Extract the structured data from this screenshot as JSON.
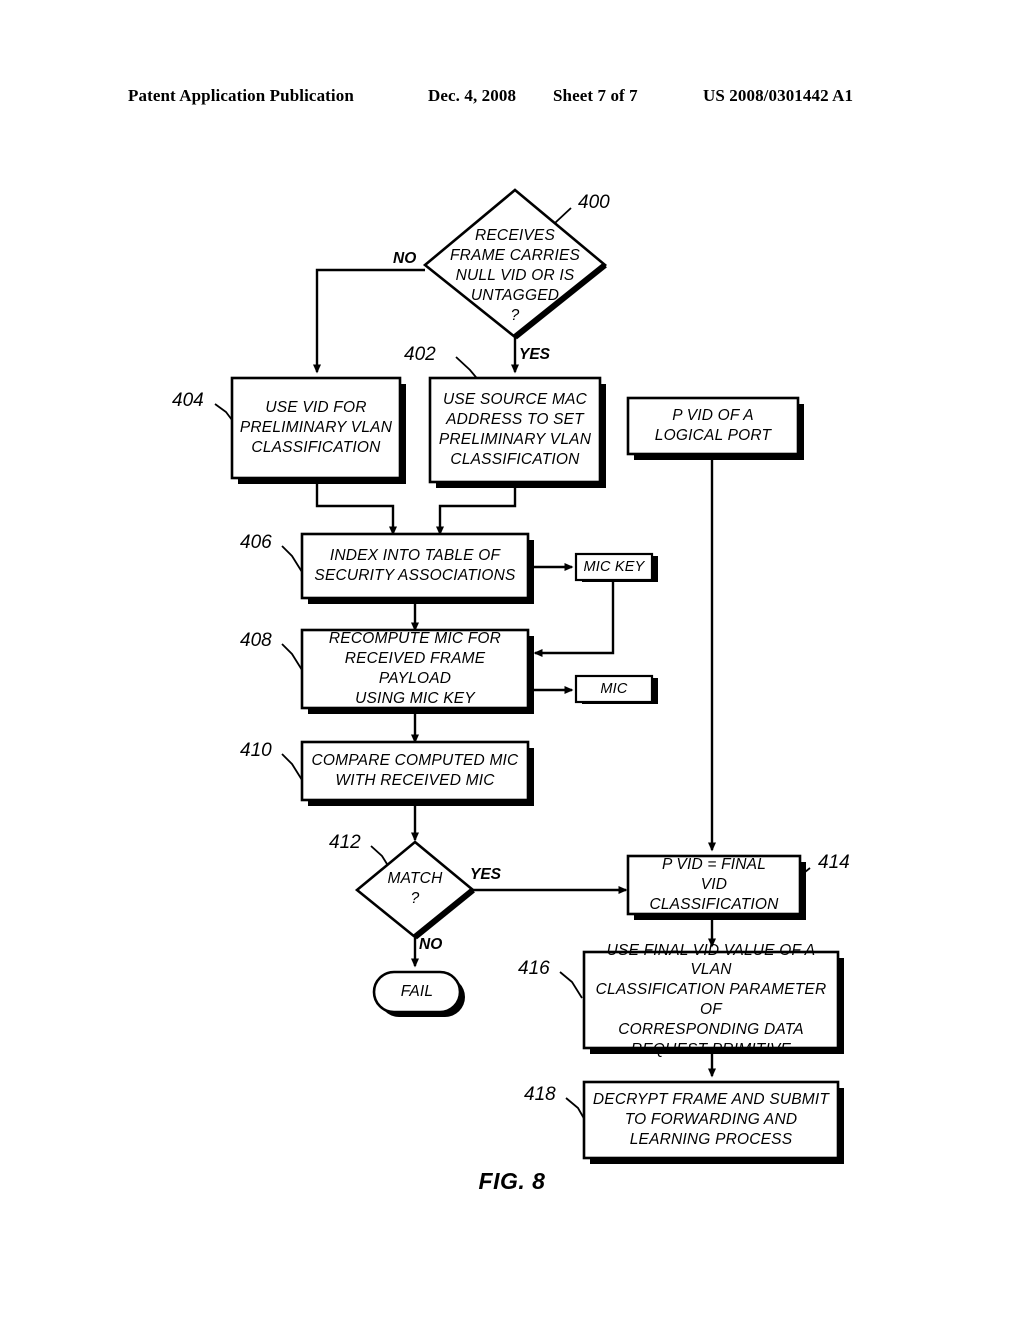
{
  "header": {
    "publication": "Patent Application Publication",
    "date": "Dec. 4, 2008",
    "sheet": "Sheet 7 of 7",
    "number": "US 2008/0301442 A1"
  },
  "figure": {
    "caption": "FIG. 8",
    "nodes": {
      "n400": {
        "ref": "400",
        "text": "RECEIVES\nFRAME CARRIES\nNULL VID OR IS\nUNTAGGED\n?",
        "shape": "decision"
      },
      "n402": {
        "ref": "402",
        "text": "USE SOURCE MAC\nADDRESS TO SET\nPRELIMINARY VLAN\nCLASSIFICATION",
        "shape": "process"
      },
      "n404": {
        "ref": "404",
        "text": "USE VID FOR\nPRELIMINARY VLAN\nCLASSIFICATION",
        "shape": "process"
      },
      "n406": {
        "ref": "406",
        "text": "INDEX INTO TABLE OF\nSECURITY ASSOCIATIONS",
        "shape": "process"
      },
      "n408": {
        "ref": "408",
        "text": "RECOMPUTE MIC FOR\nRECEIVED FRAME PAYLOAD\nUSING MIC KEY",
        "shape": "process"
      },
      "n410": {
        "ref": "410",
        "text": "COMPARE COMPUTED MIC\nWITH RECEIVED MIC",
        "shape": "process"
      },
      "n412": {
        "ref": "412",
        "text": "MATCH\n?",
        "shape": "decision"
      },
      "n414": {
        "ref": "414",
        "text": "P VID = FINAL\nVID CLASSIFICATION",
        "shape": "process"
      },
      "n416": {
        "ref": "416",
        "text": "USE FINAL VID VALUE OF A VLAN\nCLASSIFICATION PARAMETER OF\nCORRESPONDING DATA\nREQUEST PRIMITIVE",
        "shape": "process"
      },
      "n418": {
        "ref": "418",
        "text": "DECRYPT FRAME AND SUBMIT\nTO FORWARDING AND\nLEARNING PROCESS",
        "shape": "process"
      },
      "pvid_port": {
        "text": "P VID OF A\nLOGICAL PORT",
        "shape": "process"
      },
      "mic_key": {
        "text": "MIC KEY",
        "shape": "process"
      },
      "mic": {
        "text": "MIC",
        "shape": "process"
      },
      "fail": {
        "text": "FAIL",
        "shape": "terminator"
      }
    },
    "branches": {
      "d400_no": "NO",
      "d400_yes": "YES",
      "d412_yes": "YES",
      "d412_no": "NO"
    },
    "colors": {
      "stroke": "#000000",
      "fill": "#ffffff",
      "background": "#ffffff"
    }
  }
}
